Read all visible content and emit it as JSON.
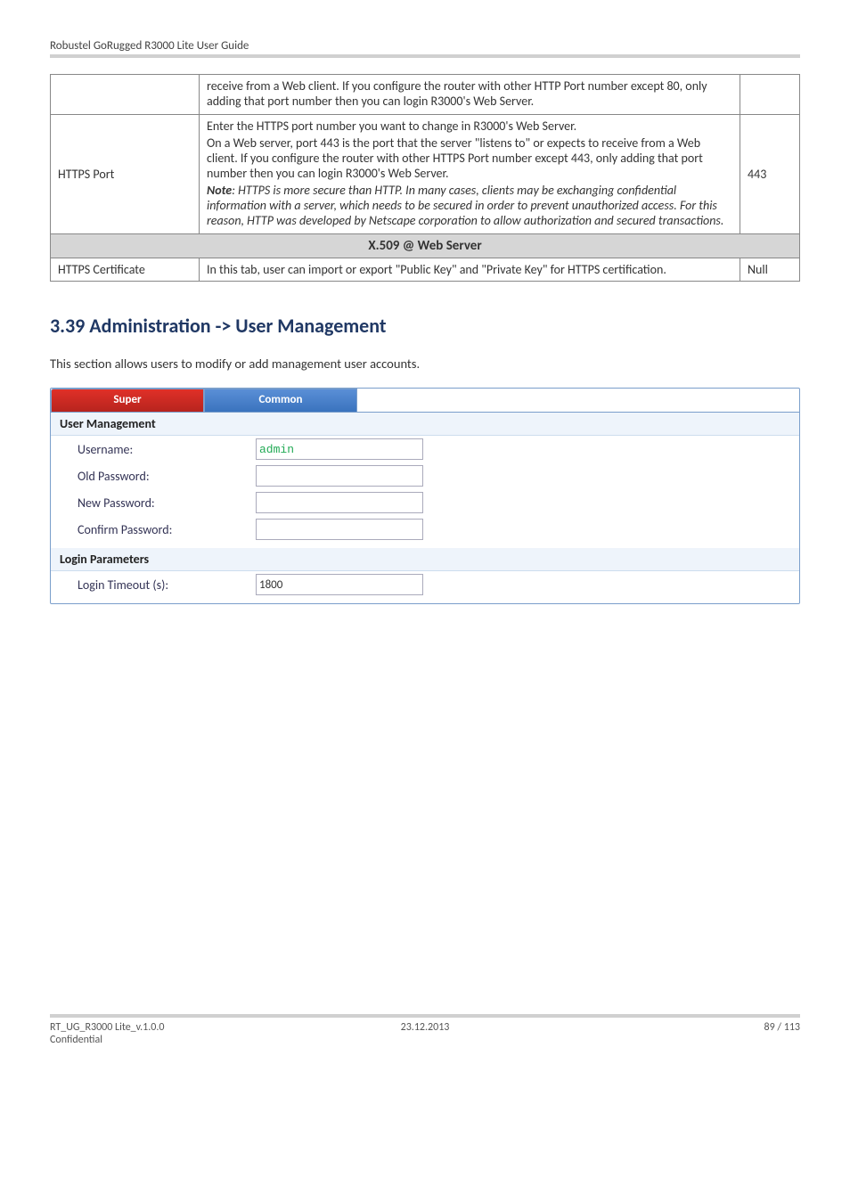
{
  "header": {
    "title": "Robustel GoRugged R3000 Lite User Guide"
  },
  "table1": {
    "row0_desc_p1": "receive from a Web client. If you configure the router with other HTTP Port number except 80, only adding that port number then you can login R3000's Web Server.",
    "row1_label": "HTTPS Port",
    "row1_val": "443",
    "row1_p1": "Enter the HTTPS port number you want to change in R3000's Web Server.",
    "row1_p2": "On a Web server, port 443 is the port that the server \"listens to\" or expects to receive from a Web client. If you configure the router with other HTTPS Port number except 443, only adding that port number then you can login R3000's Web Server.",
    "row1_note_bold": "Note",
    "row1_note_rest": ": HTTPS is more secure than HTTP. In many cases, clients may be exchanging confidential information with a server, which needs to be secured in order to prevent unauthorized access. For this reason, HTTP was developed by Netscape corporation to allow authorization and secured transactions.",
    "sub_header": "X.509 @ Web Server",
    "row2_label": "HTTPS Certificate",
    "row2_desc": "In this tab, user can import or export \"Public Key\" and \"Private Key\" for HTTPS certification.",
    "row2_val": "Null"
  },
  "section": {
    "heading": "3.39  Administration -> User Management",
    "intro": "This section allows users to modify or add management user accounts."
  },
  "tabs": {
    "super": "Super",
    "common": "Common"
  },
  "form": {
    "user_mgmt_header": "User Management",
    "username_label": "Username:",
    "username_value": "admin",
    "old_pw_label": "Old Password:",
    "new_pw_label": "New Password:",
    "confirm_pw_label": "Confirm Password:",
    "login_params_header": "Login Parameters",
    "login_timeout_label": "Login Timeout (s):",
    "login_timeout_value": "1800"
  },
  "footer": {
    "left1": "RT_UG_R3000 Lite_v.1.0.0",
    "left2": "Confidential",
    "center": "23.12.2013",
    "right": "89 / 113"
  }
}
